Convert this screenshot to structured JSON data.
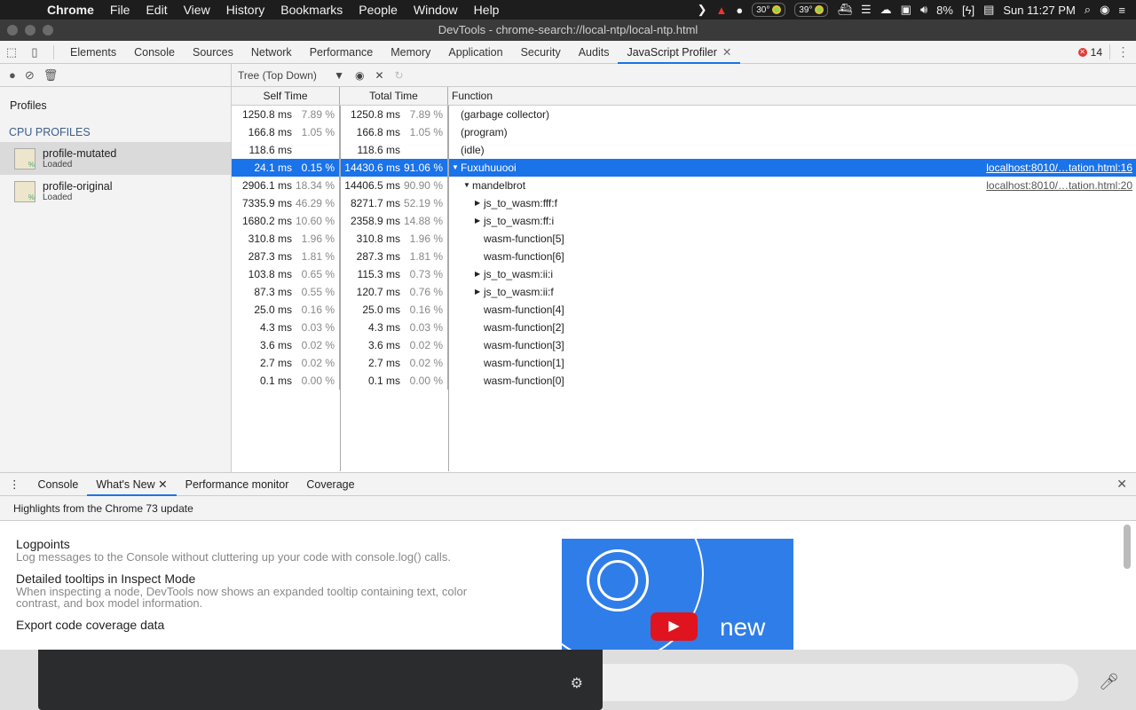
{
  "menubar": {
    "app": "Chrome",
    "items": [
      "File",
      "Edit",
      "View",
      "History",
      "Bookmarks",
      "People",
      "Window",
      "Help"
    ],
    "temp1": "30°",
    "temp2": "39°",
    "battery": "8%",
    "clock": "Sun 11:27 PM"
  },
  "window": {
    "title": "DevTools - chrome-search://local-ntp/local-ntp.html"
  },
  "devtools": {
    "tabs": [
      "Elements",
      "Console",
      "Sources",
      "Network",
      "Performance",
      "Memory",
      "Application",
      "Security",
      "Audits",
      "JavaScript Profiler"
    ],
    "active_tab": "JavaScript Profiler",
    "error_count": "14"
  },
  "sidebar": {
    "title": "Profiles",
    "section": "CPU PROFILES",
    "profiles": [
      {
        "name": "profile-mutated",
        "status": "Loaded"
      },
      {
        "name": "profile-original",
        "status": "Loaded"
      }
    ]
  },
  "profiler": {
    "view": "Tree (Top Down)",
    "headers": {
      "self": "Self Time",
      "total": "Total Time",
      "function": "Function"
    },
    "rows": [
      {
        "self": "1250.8 ms",
        "selfp": "7.89 %",
        "total": "1250.8 ms",
        "totalp": "7.89 %",
        "fn": "(garbage collector)",
        "indent": 0,
        "tri": "",
        "url": ""
      },
      {
        "self": "166.8 ms",
        "selfp": "1.05 %",
        "total": "166.8 ms",
        "totalp": "1.05 %",
        "fn": "(program)",
        "indent": 0,
        "tri": "",
        "url": ""
      },
      {
        "self": "118.6 ms",
        "selfp": "",
        "total": "118.6 ms",
        "totalp": "",
        "fn": "(idle)",
        "indent": 0,
        "tri": "",
        "url": ""
      },
      {
        "self": "24.1 ms",
        "selfp": "0.15 %",
        "total": "14430.6 ms",
        "totalp": "91.06 %",
        "fn": "Fuxuhuuooi",
        "indent": 0,
        "tri": "▼",
        "url": "localhost:8010/…tation.html:16",
        "selected": true
      },
      {
        "self": "2906.1 ms",
        "selfp": "18.34 %",
        "total": "14406.5 ms",
        "totalp": "90.90 %",
        "fn": "mandelbrot",
        "indent": 1,
        "tri": "▼",
        "url": "localhost:8010/…tation.html:20"
      },
      {
        "self": "7335.9 ms",
        "selfp": "46.29 %",
        "total": "8271.7 ms",
        "totalp": "52.19 %",
        "fn": "js_to_wasm:fff:f",
        "indent": 2,
        "tri": "▶",
        "url": ""
      },
      {
        "self": "1680.2 ms",
        "selfp": "10.60 %",
        "total": "2358.9 ms",
        "totalp": "14.88 %",
        "fn": "js_to_wasm:ff:i",
        "indent": 2,
        "tri": "▶",
        "url": ""
      },
      {
        "self": "310.8 ms",
        "selfp": "1.96 %",
        "total": "310.8 ms",
        "totalp": "1.96 %",
        "fn": "wasm-function[5]",
        "indent": 2,
        "tri": "",
        "url": ""
      },
      {
        "self": "287.3 ms",
        "selfp": "1.81 %",
        "total": "287.3 ms",
        "totalp": "1.81 %",
        "fn": "wasm-function[6]",
        "indent": 2,
        "tri": "",
        "url": ""
      },
      {
        "self": "103.8 ms",
        "selfp": "0.65 %",
        "total": "115.3 ms",
        "totalp": "0.73 %",
        "fn": "js_to_wasm:ii:i",
        "indent": 2,
        "tri": "▶",
        "url": ""
      },
      {
        "self": "87.3 ms",
        "selfp": "0.55 %",
        "total": "120.7 ms",
        "totalp": "0.76 %",
        "fn": "js_to_wasm:ii:f",
        "indent": 2,
        "tri": "▶",
        "url": ""
      },
      {
        "self": "25.0 ms",
        "selfp": "0.16 %",
        "total": "25.0 ms",
        "totalp": "0.16 %",
        "fn": "wasm-function[4]",
        "indent": 2,
        "tri": "",
        "url": ""
      },
      {
        "self": "4.3 ms",
        "selfp": "0.03 %",
        "total": "4.3 ms",
        "totalp": "0.03 %",
        "fn": "wasm-function[2]",
        "indent": 2,
        "tri": "",
        "url": ""
      },
      {
        "self": "3.6 ms",
        "selfp": "0.02 %",
        "total": "3.6 ms",
        "totalp": "0.02 %",
        "fn": "wasm-function[3]",
        "indent": 2,
        "tri": "",
        "url": ""
      },
      {
        "self": "2.7 ms",
        "selfp": "0.02 %",
        "total": "2.7 ms",
        "totalp": "0.02 %",
        "fn": "wasm-function[1]",
        "indent": 2,
        "tri": "",
        "url": ""
      },
      {
        "self": "0.1 ms",
        "selfp": "0.00 %",
        "total": "0.1 ms",
        "totalp": "0.00 %",
        "fn": "wasm-function[0]",
        "indent": 2,
        "tri": "",
        "url": ""
      }
    ]
  },
  "drawer": {
    "tabs": [
      "Console",
      "What's New",
      "Performance monitor",
      "Coverage"
    ],
    "active_tab": "What's New",
    "subtitle": "Highlights from the Chrome 73 update",
    "items": [
      {
        "title": "Logpoints",
        "desc": "Log messages to the Console without cluttering up your code with console.log() calls."
      },
      {
        "title": "Detailed tooltips in Inspect Mode",
        "desc": "When inspecting a node, DevTools now shows an expanded tooltip containing text, color contrast, and box model information."
      },
      {
        "title": "Export code coverage data",
        "desc": ""
      }
    ],
    "video_text": "new"
  }
}
